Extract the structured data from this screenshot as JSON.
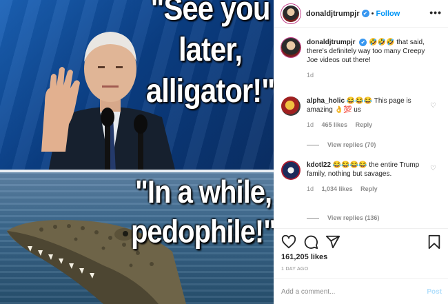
{
  "media": {
    "caption_top": "\"See you later, alligator!\"",
    "caption_bottom": "\"In a while, pedophile!\""
  },
  "header": {
    "username": "donaldjtrumpjr",
    "verified_mark": "✔",
    "separator": "•",
    "follow_label": "Follow",
    "more_label": "•••"
  },
  "caption": {
    "username": "donaldjtrumpjr",
    "verified_mark": "✔",
    "text": "🤣🤣🤣 that said, there's definitely way too many Creepy Joe videos out there!",
    "time": "1d"
  },
  "comments": [
    {
      "username": "alpha_holic",
      "text": "😂😂😂 This page is amazing 👌💯 us",
      "time": "1d",
      "likes": "465 likes",
      "reply_label": "Reply",
      "view_replies": "View replies (70)"
    },
    {
      "username": "kdotl22",
      "text": "😂😂😂😂 the entire Trump family, nothing but savages.",
      "time": "1d",
      "likes": "1,034 likes",
      "reply_label": "Reply",
      "view_replies": "View replies (136)"
    }
  ],
  "actions": {
    "likes": "161,205 likes",
    "posted_ago": "1 DAY AGO"
  },
  "add_comment": {
    "placeholder": "Add a comment...",
    "post_label": "Post"
  },
  "colors": {
    "link_blue": "#0095f6",
    "verified_blue": "#3897f0",
    "muted": "#8e8e8e",
    "post_disabled": "#b2dffc"
  },
  "icons": [
    "heart-icon",
    "comment-icon",
    "share-icon",
    "bookmark-icon",
    "more-icon"
  ]
}
